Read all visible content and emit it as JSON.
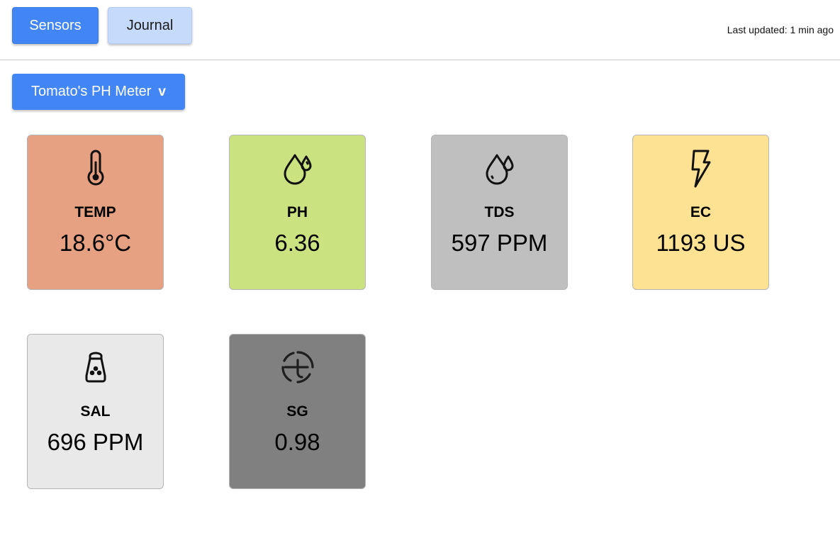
{
  "nav": {
    "sensors_label": "Sensors",
    "journal_label": "Journal",
    "last_updated": "Last updated: 1 min ago"
  },
  "device": {
    "selected": "Tomato's PH Meter",
    "chevron": "v"
  },
  "cards": [
    {
      "label": "TEMP",
      "value": "18.6°C",
      "icon": "thermometer-icon",
      "color": "#e6a082"
    },
    {
      "label": "PH",
      "value": "6.36",
      "icon": "water-drops-icon",
      "color": "#cbe280"
    },
    {
      "label": "TDS",
      "value": "597 PPM",
      "icon": "water-drops-icon",
      "color": "#bfbfbf"
    },
    {
      "label": "EC",
      "value": "1193 US",
      "icon": "lightning-bolt-icon",
      "color": "#fde294"
    },
    {
      "label": "SAL",
      "value": "696 PPM",
      "icon": "salt-shaker-icon",
      "color": "#e9e9e9"
    },
    {
      "label": "SG",
      "value": "0.98",
      "icon": "gauge-circle-icon",
      "color": "#808080"
    }
  ]
}
